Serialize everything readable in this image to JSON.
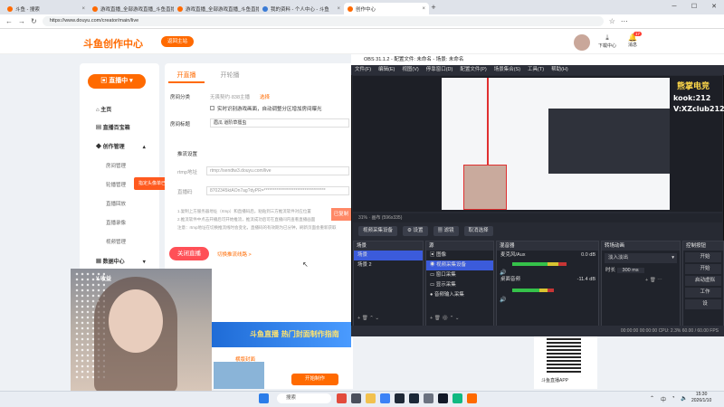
{
  "browser": {
    "tabs": [
      {
        "title": "斗鱼 - 搜索",
        "active": false
      },
      {
        "title": "游戏直播_全部游戏直播_斗鱼直播",
        "active": false
      },
      {
        "title": "游戏直播_全部游戏直播_斗鱼直播",
        "active": false
      },
      {
        "title": "我的资料 - 个人中心 - 斗鱼",
        "active": false
      },
      {
        "title": "创作中心",
        "active": true
      }
    ],
    "url": "https://www.douyu.com/creator/main/live"
  },
  "site": {
    "logo_text": "斗鱼创作中心",
    "return_button": "返回主站",
    "download_label": "下载中心",
    "message_label": "消息",
    "message_badge": "17"
  },
  "sidebar": {
    "live_button": "直播中",
    "items": [
      {
        "label": "主页",
        "level": "top"
      },
      {
        "label": "直播百宝箱",
        "level": "top"
      },
      {
        "label": "创作管理",
        "level": "top"
      },
      {
        "label": "房间管理",
        "level": "sub"
      },
      {
        "label": "轮播管理",
        "level": "sub"
      },
      {
        "label": "直播回放",
        "level": "sub"
      },
      {
        "label": "直播录像",
        "level": "sub"
      },
      {
        "label": "视频管理",
        "level": "sub"
      },
      {
        "label": "数据中心",
        "level": "top"
      },
      {
        "label": "收益",
        "level": "top"
      }
    ],
    "tooltip": "指定头像单已全部打开个，一键不重挂~"
  },
  "main": {
    "tabs": [
      "开直播",
      "开轮播"
    ],
    "room_category_label": "房间分类",
    "room_category_value": "无畏契约·838主播",
    "room_category_link": "选择",
    "checkbox_label": "实时识别游戏画面，自动调整分区增加房间曝光",
    "room_title_label": "房间标题",
    "room_title_value": "眉瓜 道阶草擂虫",
    "push_settings_label": "推流设置",
    "rtmp_label": "rtmp地址",
    "rtmp_value": "rtmp://sendtw3.douyu.com/live",
    "stream_code_label": "直播码",
    "stream_code_value": "8702345ktAOn7ag?dyPR=***********************************",
    "copy_button": "已复制",
    "note_1": "1.复制上方服务器地址（rtmp）和直播码后，粘贴到三方推流软件对应位置",
    "note_2": "2.推流软件中点击开播后可开始推流，推流成功后可在直播间内查看直播画面",
    "note_3": "注意：rtmp地址在切换推流线时会变化，直播码的有效期为已分钟，刷新页面会重新获取",
    "close_live_button": "关闭直播",
    "switch_line_link": "切换推流线路 >",
    "banner_text": "斗鱼直播 热门封面制作指南",
    "cover_label": "横版封面",
    "cover_button": "开始制作",
    "qr_caption": "斗鱼直播APP"
  },
  "obs": {
    "title": "OBS 31.1.2 - 配置文件: 未命名 - 场景: 未命名",
    "menu": [
      "文件(F)",
      "编辑(E)",
      "视图(V)",
      "停靠窗口(D)",
      "配置文件(P)",
      "场景集合(S)",
      "工具(T)",
      "帮助(H)"
    ],
    "watermark_line1": "熊掌电竞",
    "watermark_line2": "kook:212",
    "watermark_line3": "V:XZclub212",
    "zoom": "31%",
    "canvas_label": "画布 (596x335)",
    "source_selector": "视频采集设备",
    "controls": [
      "设置",
      "滤镜",
      "取消选择"
    ],
    "docks": {
      "scenes": {
        "title": "场景",
        "items": [
          "场景",
          "场景 2"
        ]
      },
      "sources": {
        "title": "源",
        "items": [
          "图像",
          "视频采集设备",
          "窗口采集",
          "显示采集",
          "音频输入采集"
        ]
      },
      "mixer": {
        "title": "混音器",
        "channels": [
          {
            "name": "麦克风/Aux",
            "db": "0.0 dB",
            "level": 0.65
          },
          {
            "name": "桌面音频",
            "db": "-11.4 dB",
            "level": 0.5
          }
        ]
      },
      "transitions": {
        "title": "转场动画",
        "type": "淡入淡出",
        "duration_label": "时长",
        "duration": "300 ms"
      },
      "controls": {
        "title": "控制按钮",
        "buttons": [
          "开始",
          "开始",
          "启动虚拟",
          "工作",
          "设"
        ]
      }
    },
    "status": {
      "cpu": "CPU: 2.3%",
      "fps": "60.00 / 60.00 FPS",
      "time1": "00:00:00",
      "time2": "00:00:00"
    }
  },
  "taskbar": {
    "search_placeholder": "搜索",
    "time": "15:30",
    "date": "2026/1/10",
    "lang": "中"
  }
}
